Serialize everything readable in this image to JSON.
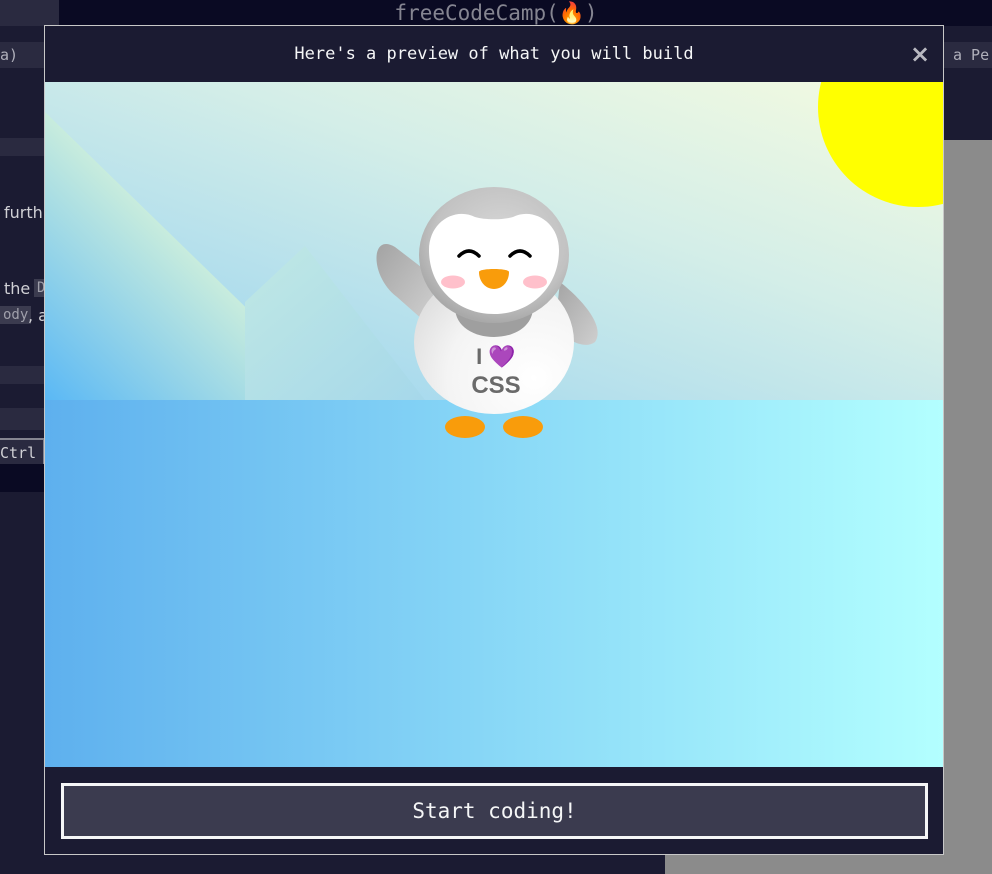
{
  "app": {
    "brand": "freeCodeCamp(🔥)"
  },
  "background": {
    "left_tab": "a)",
    "right_tab": "a Pe",
    "text_line1": "furth",
    "text_line2": "the",
    "code_line2": "D",
    "code_line3": "ody",
    "text_line3": ", a",
    "kbd": "Ctrl + E"
  },
  "modal": {
    "title": "Here's a preview of what you will build",
    "close_label": "×",
    "start_label": "Start coding!"
  },
  "preview": {
    "shirt_line1": "I",
    "shirt_heart": "💜",
    "shirt_line2": "CSS"
  },
  "colors": {
    "sun": "#ffff00",
    "sky_start": "#b4e0ee",
    "ground_start": "#5eb0ee",
    "ground_end": "#b3ffff",
    "beak": "#f99c0b",
    "cheek": "#ffc0cb"
  }
}
